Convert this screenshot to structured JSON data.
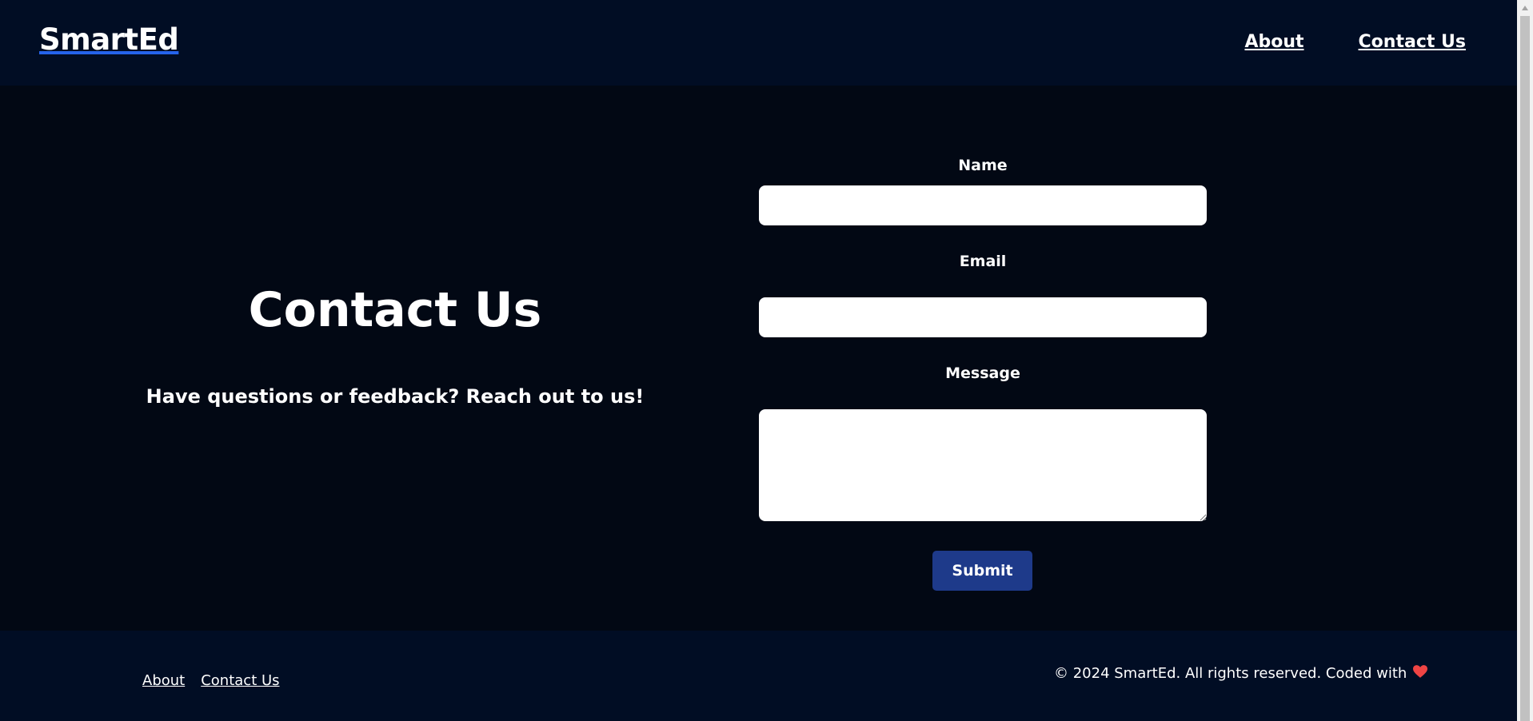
{
  "header": {
    "logo": "SmartEd",
    "nav": {
      "about": "About",
      "contact": "Contact Us"
    }
  },
  "hero": {
    "title": "Contact Us",
    "subtitle": "Have questions or feedback? Reach out to us!"
  },
  "form": {
    "name_label": "Name",
    "name_value": "",
    "email_label": "Email",
    "email_value": "",
    "message_label": "Message",
    "message_value": "",
    "submit_label": "Submit"
  },
  "footer": {
    "links": {
      "about": "About",
      "contact": "Contact Us"
    },
    "copyright": "© 2024 SmartEd. All rights reserved. Coded with"
  },
  "colors": {
    "header_bg": "#010d24",
    "main_bg": "#020814",
    "accent": "#2563eb",
    "button": "#1e3a8a",
    "heart": "#ef4444"
  },
  "icons": {
    "heart": "heart-icon",
    "scroll_up": "scroll-up-arrow-icon"
  }
}
